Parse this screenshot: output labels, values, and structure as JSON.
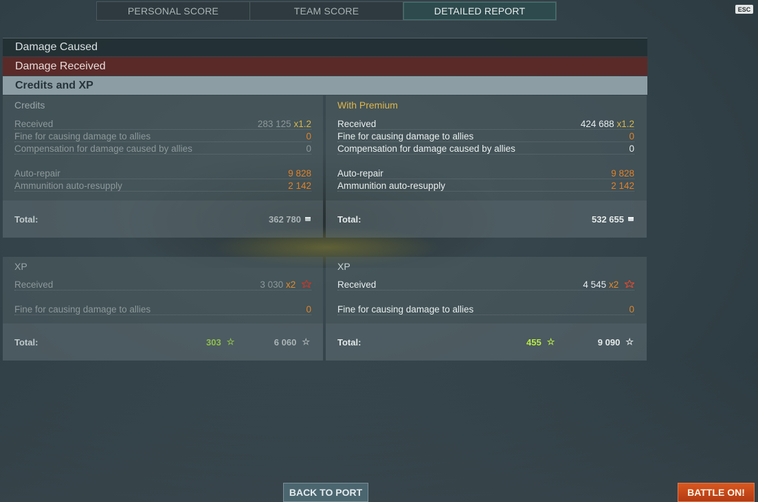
{
  "tabs": [
    "PERSONAL SCORE",
    "TEAM SCORE",
    "DETAILED REPORT"
  ],
  "esc_label": "ESC",
  "sections": {
    "damage_caused": "Damage Caused",
    "damage_received": "Damage Received",
    "credits_xp": "Credits and XP"
  },
  "credits": {
    "left_header": "Credits",
    "right_header": "With Premium",
    "left_rows": [
      {
        "label": "Received",
        "value": "283 125",
        "mult": "x1.2"
      },
      {
        "label": "Fine for causing damage to allies",
        "value": "0"
      },
      {
        "label": "Compensation for damage caused by allies",
        "value": "0"
      },
      {
        "label": "Auto-repair",
        "value": "9 828"
      },
      {
        "label": "Ammunition auto-resupply",
        "value": "2 142"
      }
    ],
    "right_rows": [
      {
        "label": "Received",
        "value": "424 688",
        "mult": "x1.2"
      },
      {
        "label": "Fine for causing damage to allies",
        "value": "0"
      },
      {
        "label": "Compensation for damage caused by allies",
        "value": "0"
      },
      {
        "label": "Auto-repair",
        "value": "9 828"
      },
      {
        "label": "Ammunition auto-resupply",
        "value": "2 142"
      }
    ],
    "total_label": "Total:",
    "left_total": "362 780",
    "right_total": "532 655"
  },
  "xp": {
    "left_header": "XP",
    "right_header": "XP",
    "left_rows": [
      {
        "label": "Received",
        "value": "3 030",
        "mult": "x2"
      },
      {
        "label": "Fine for causing damage to allies",
        "value": "0"
      }
    ],
    "right_rows": [
      {
        "label": "Received",
        "value": "4 545",
        "mult": "x2"
      },
      {
        "label": "Fine for causing damage to allies",
        "value": "0"
      }
    ],
    "total_label": "Total:",
    "left_total_elite": "303",
    "left_total": "6 060",
    "right_total_elite": "455",
    "right_total": "9 090"
  },
  "buttons": {
    "back": "BACK TO PORT",
    "battle": "BATTLE ON!"
  },
  "icons": {
    "credits": "silver-coin-icon",
    "xp": "star-icon",
    "flag": "signal-flag-icon"
  }
}
